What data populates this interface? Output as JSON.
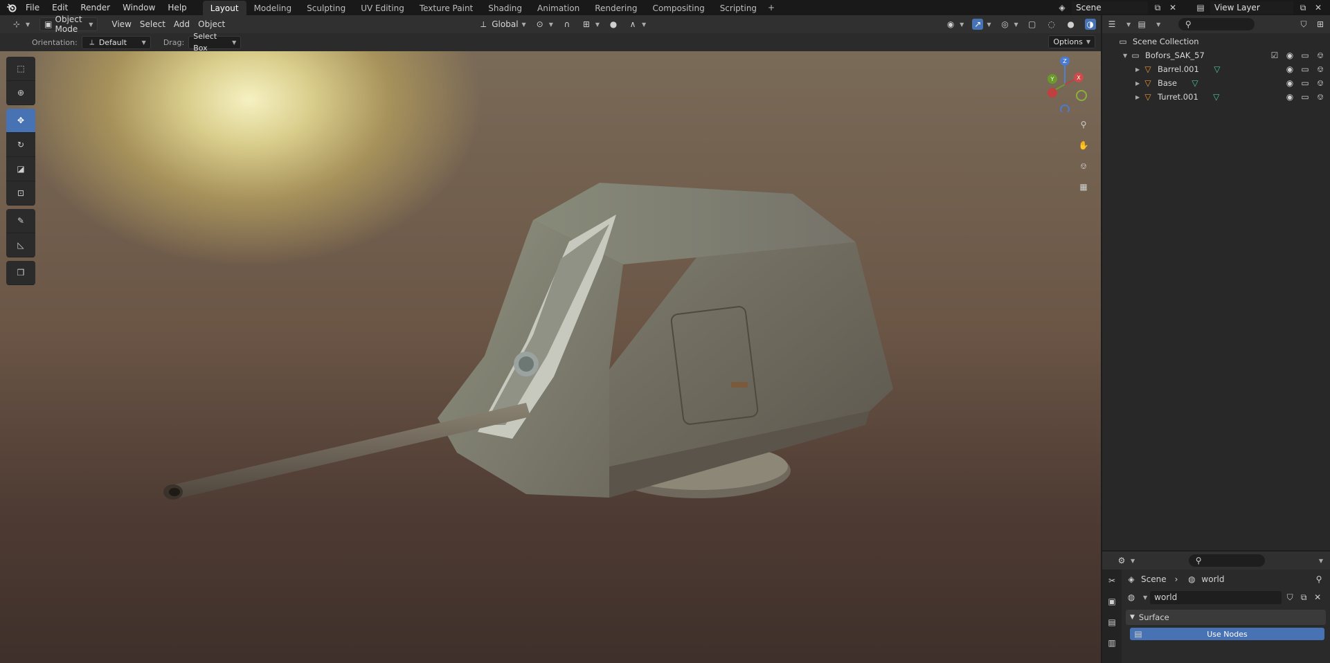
{
  "menu": {
    "items": [
      "File",
      "Edit",
      "Render",
      "Window",
      "Help"
    ]
  },
  "workspaces": {
    "tabs": [
      "Layout",
      "Modeling",
      "Sculpting",
      "UV Editing",
      "Texture Paint",
      "Shading",
      "Animation",
      "Rendering",
      "Compositing",
      "Scripting"
    ],
    "active": "Layout",
    "add": "+"
  },
  "scene": {
    "name": "Scene"
  },
  "view_layer": {
    "name": "View Layer"
  },
  "viewport_header": {
    "mode": "Object Mode",
    "menus": [
      "View",
      "Select",
      "Add",
      "Object"
    ],
    "transform_orientation": "Global"
  },
  "tool_settings": {
    "orientation_label": "Orientation:",
    "orientation_value": "Default",
    "drag_label": "Drag:",
    "drag_value": "Select Box",
    "options": "Options"
  },
  "gizmo": {
    "z": "Z",
    "y": "Y",
    "x": "X"
  },
  "outliner": {
    "root": "Scene Collection",
    "collection": "Bofors_SAK_57",
    "objects": [
      "Barrel.001",
      "Base",
      "Turret.001"
    ]
  },
  "properties": {
    "breadcrumb_scene": "Scene",
    "breadcrumb_sep": "›",
    "breadcrumb_world": "world",
    "world_name": "world",
    "panel": "Surface",
    "use_nodes": "Use Nodes"
  },
  "colors": {
    "accent": "#4772b3",
    "mesh_icon": "#e8943a",
    "mesh_data_icon": "#4fc3a1"
  }
}
